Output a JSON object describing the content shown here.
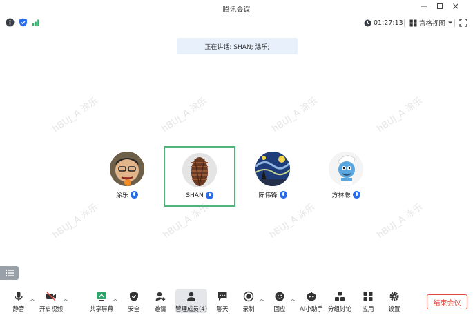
{
  "window": {
    "title": "腾讯会议"
  },
  "infobar": {
    "timer": "01:27:13",
    "view_mode": "宫格视图"
  },
  "stage": {
    "speaking": "正在讲话: SHAN; 涂乐;",
    "watermark": "hBUJ_A 涂乐"
  },
  "participants": [
    {
      "name": "涂乐",
      "active": false
    },
    {
      "name": "SHAN",
      "active": true
    },
    {
      "name": "陈伟锋",
      "active": false
    },
    {
      "name": "方林聪",
      "active": false
    }
  ],
  "toolbar": {
    "mute": "静音",
    "video": "开启视频",
    "share": "共享屏幕",
    "security": "安全",
    "invite": "邀请",
    "manage": "管理成员(4)",
    "chat": "聊天",
    "record": "录制",
    "replay": "回应",
    "ai": "AI小助手",
    "breakout": "分组讨论",
    "apps": "应用",
    "settings": "设置",
    "end": "结束会议"
  },
  "colors": {
    "accent": "#2b6de8",
    "active_border": "#52b478",
    "end": "#e0463a",
    "signal": "#2fb56a"
  }
}
